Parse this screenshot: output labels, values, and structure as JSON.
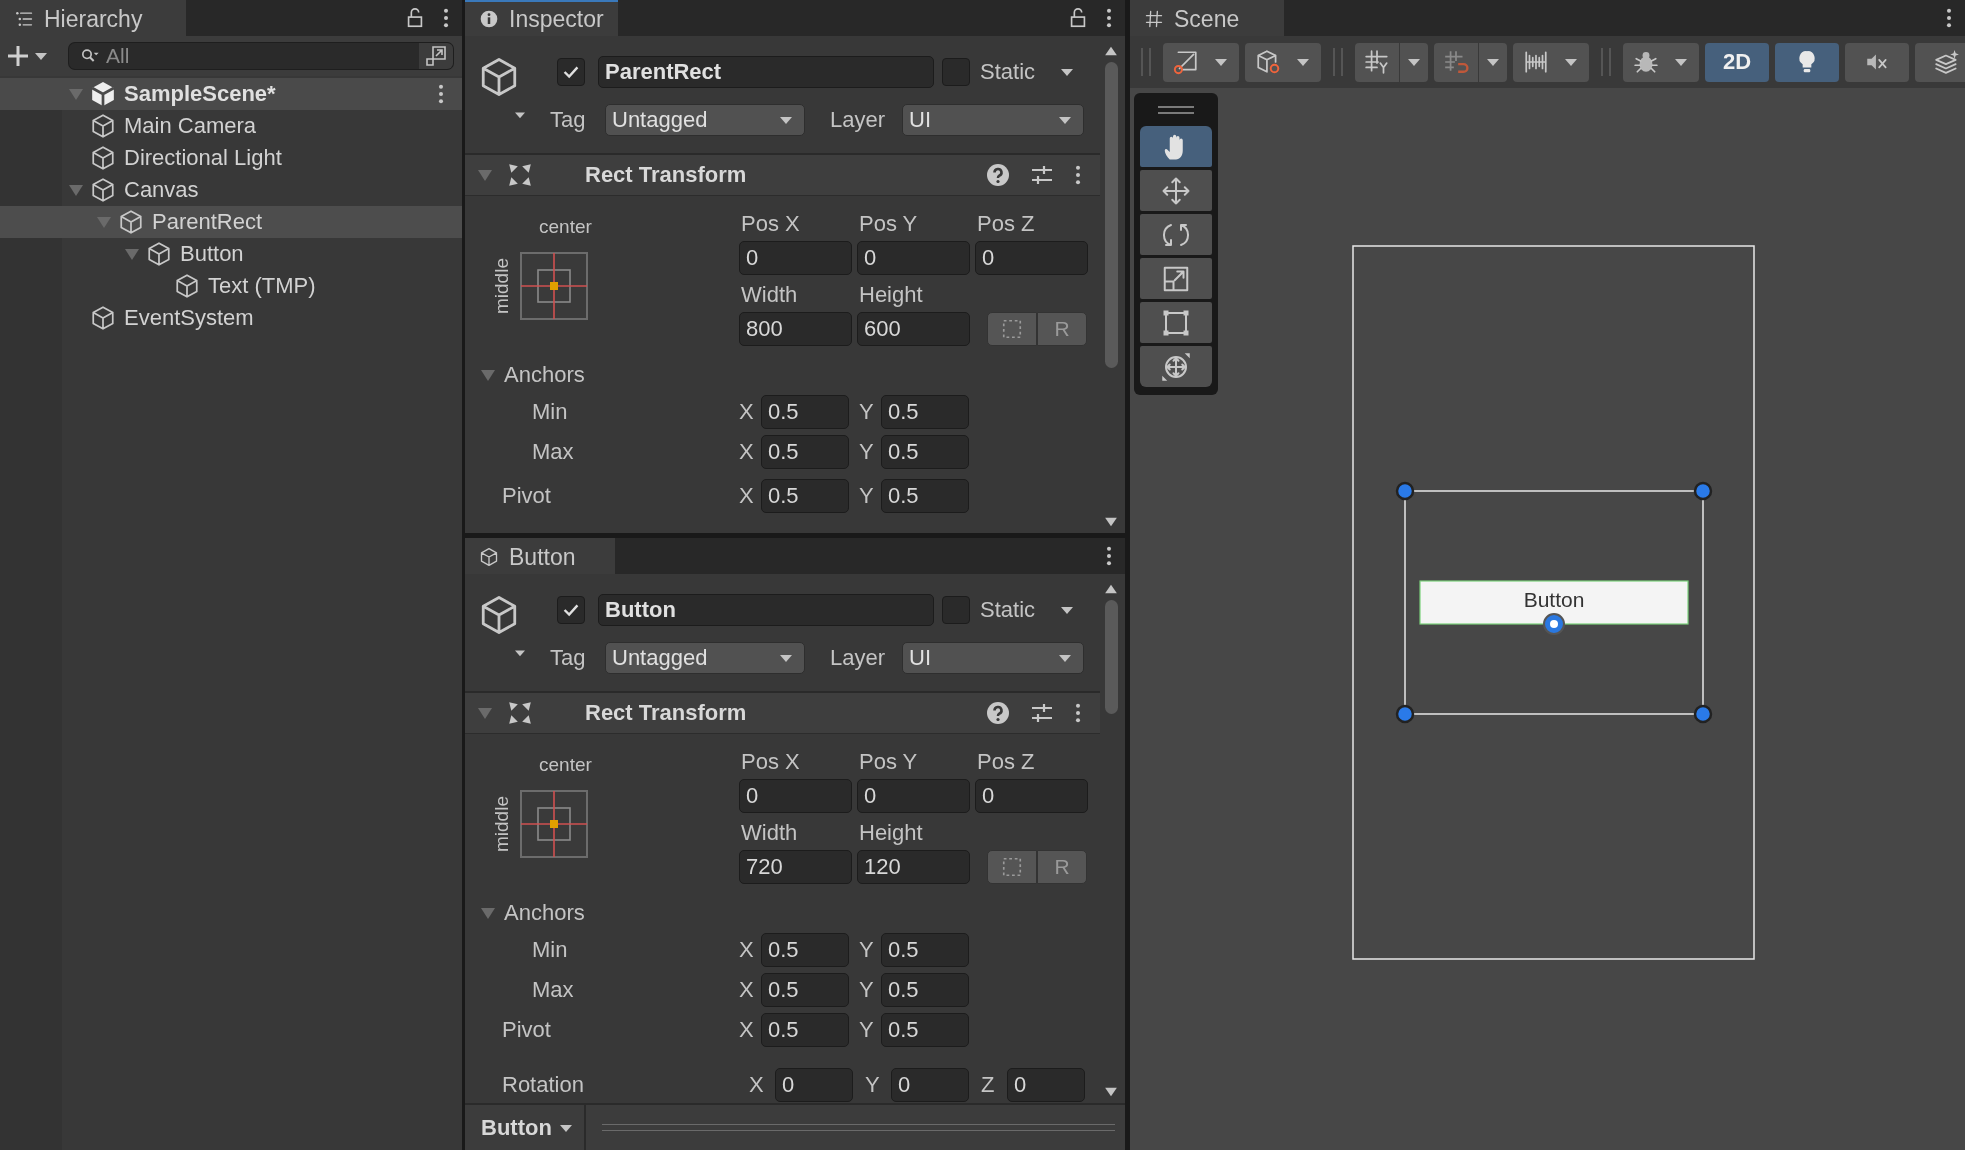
{
  "hierarchy": {
    "tab": {
      "kind": "list",
      "label": "Hierarchy",
      "focused": false
    },
    "search": {
      "placeholder": "All"
    },
    "scene": {
      "name": "SampleScene*",
      "expanded": true,
      "children": [
        {
          "name": "Main Camera",
          "selected": false
        },
        {
          "name": "Directional Light",
          "selected": false
        },
        {
          "name": "Canvas",
          "selected": false,
          "expanded": true,
          "children": [
            {
              "name": "ParentRect",
              "selected": true,
              "expanded": true,
              "children": [
                {
                  "name": "Button",
                  "selected": false,
                  "expanded": true,
                  "children": [
                    {
                      "name": "Text (TMP)",
                      "selected": false
                    }
                  ]
                }
              ]
            }
          ]
        },
        {
          "name": "EventSystem",
          "selected": false
        }
      ]
    }
  },
  "inspectors": [
    {
      "tab": {
        "kind": "info",
        "label": "Inspector",
        "focused": true
      },
      "lock_button": true,
      "object": {
        "active": true,
        "name": "ParentRect",
        "static": false,
        "static_label": "Static",
        "tag_label": "Tag",
        "tag": "Untagged",
        "layer_label": "Layer",
        "layer": "UI"
      },
      "rect_transform": {
        "title": "Rect Transform",
        "expanded": true,
        "anchor_h": "center",
        "anchor_v": "middle",
        "position": [
          {
            "label": "Pos X",
            "value": "0"
          },
          {
            "label": "Pos Y",
            "value": "0"
          },
          {
            "label": "Pos Z",
            "value": "0"
          }
        ],
        "size": [
          {
            "label": "Width",
            "value": "800"
          },
          {
            "label": "Height",
            "value": "600"
          }
        ],
        "raw_button": "R",
        "anchors": {
          "label": "Anchors",
          "expanded": true,
          "rows": [
            {
              "label": "Min",
              "fields": [
                {
                  "axis": "X",
                  "value": "0.5"
                },
                {
                  "axis": "Y",
                  "value": "0.5"
                }
              ]
            },
            {
              "label": "Max",
              "fields": [
                {
                  "axis": "X",
                  "value": "0.5"
                },
                {
                  "axis": "Y",
                  "value": "0.5"
                }
              ]
            }
          ]
        },
        "rows": [
          {
            "label": "Pivot",
            "fields": [
              {
                "axis": "X",
                "value": "0.5"
              },
              {
                "axis": "Y",
                "value": "0.5"
              }
            ]
          }
        ]
      }
    },
    {
      "tab": {
        "kind": "cube",
        "label": "Button",
        "focused": false
      },
      "lock_button": false,
      "object": {
        "active": true,
        "name": "Button",
        "static": false,
        "static_label": "Static",
        "tag_label": "Tag",
        "tag": "Untagged",
        "layer_label": "Layer",
        "layer": "UI"
      },
      "rect_transform": {
        "title": "Rect Transform",
        "expanded": true,
        "anchor_h": "center",
        "anchor_v": "middle",
        "position": [
          {
            "label": "Pos X",
            "value": "0"
          },
          {
            "label": "Pos Y",
            "value": "0"
          },
          {
            "label": "Pos Z",
            "value": "0"
          }
        ],
        "size": [
          {
            "label": "Width",
            "value": "720"
          },
          {
            "label": "Height",
            "value": "120"
          }
        ],
        "raw_button": "R",
        "anchors": {
          "label": "Anchors",
          "expanded": true,
          "rows": [
            {
              "label": "Min",
              "fields": [
                {
                  "axis": "X",
                  "value": "0.5"
                },
                {
                  "axis": "Y",
                  "value": "0.5"
                }
              ]
            },
            {
              "label": "Max",
              "fields": [
                {
                  "axis": "X",
                  "value": "0.5"
                },
                {
                  "axis": "Y",
                  "value": "0.5"
                }
              ]
            }
          ]
        },
        "rows": [
          {
            "label": "Pivot",
            "fields": [
              {
                "axis": "X",
                "value": "0.5"
              },
              {
                "axis": "Y",
                "value": "0.5"
              }
            ]
          },
          {
            "label": "Rotation",
            "fields": [
              {
                "axis": "X",
                "value": "0"
              },
              {
                "axis": "Y",
                "value": "0"
              },
              {
                "axis": "Z",
                "value": "0"
              }
            ]
          }
        ]
      },
      "footer": {
        "label": "Button"
      }
    }
  ],
  "scene": {
    "tab": {
      "kind": "hash",
      "label": "Scene",
      "focused": false
    },
    "toolbar": [
      {
        "items": [
          {
            "kind": "gizmo",
            "on": false
          },
          {
            "kind": "view",
            "on": false
          }
        ]
      },
      {
        "items": [
          {
            "kind": "grid",
            "on": false
          },
          {
            "kind": "snap",
            "on": false
          },
          {
            "kind": "increment",
            "on": false
          }
        ]
      },
      {
        "items": [
          {
            "kind": "gizmos",
            "on": false
          },
          {
            "kind": "dimension",
            "label": "2D",
            "on": true
          },
          {
            "kind": "lighting",
            "on": true
          },
          {
            "kind": "audio",
            "on": false
          },
          {
            "kind": "effects",
            "on": false
          }
        ]
      }
    ],
    "tools": [
      {
        "kind": "hand",
        "selected": true
      },
      {
        "kind": "move",
        "selected": false
      },
      {
        "kind": "rotate",
        "selected": false
      },
      {
        "kind": "scale",
        "selected": false
      },
      {
        "kind": "rect",
        "selected": false
      },
      {
        "kind": "transform",
        "selected": false
      }
    ],
    "view": {
      "button_label": "Button"
    }
  }
}
